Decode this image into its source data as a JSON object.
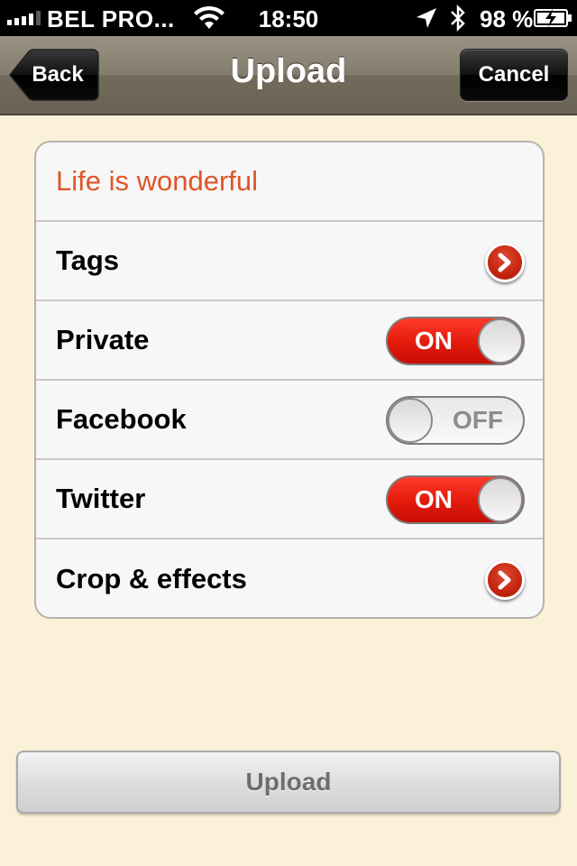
{
  "status_bar": {
    "carrier": "BEL PRO...",
    "time": "18:50",
    "battery_percent": "98 %",
    "icons": [
      "signal-icon",
      "wifi-icon",
      "location-icon",
      "bluetooth-icon",
      "battery-charging-icon"
    ]
  },
  "nav": {
    "title": "Upload",
    "back_label": "Back",
    "cancel_label": "Cancel"
  },
  "form": {
    "photo_title": "Life is wonderful",
    "rows": [
      {
        "label": "Tags",
        "control": "disclosure"
      },
      {
        "label": "Private",
        "control": "switch",
        "state": "ON"
      },
      {
        "label": "Facebook",
        "control": "switch",
        "state": "OFF"
      },
      {
        "label": "Twitter",
        "control": "switch",
        "state": "ON"
      },
      {
        "label": "Crop & effects",
        "control": "disclosure"
      }
    ]
  },
  "upload_button_label": "Upload",
  "colors": {
    "accent_red": "#e21a0c",
    "title_orange": "#e0552a",
    "background": "#fbf1d8"
  }
}
